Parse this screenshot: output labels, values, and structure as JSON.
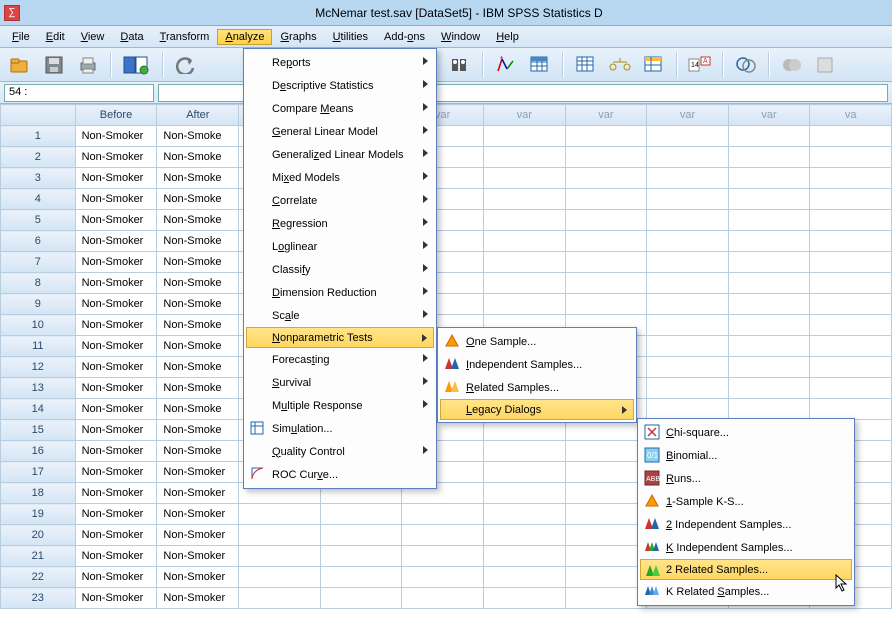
{
  "window": {
    "title": "McNemar test.sav [DataSet5] - IBM SPSS Statistics D"
  },
  "menubar": {
    "file": "File",
    "edit": "Edit",
    "view": "View",
    "data": "Data",
    "transform": "Transform",
    "analyze": "Analyze",
    "graphs": "Graphs",
    "utilities": "Utilities",
    "addons": "Add-ons",
    "window": "Window",
    "help": "Help"
  },
  "ref": {
    "cell": "54 :"
  },
  "columns": {
    "c1": "Before",
    "c2": "After",
    "var": "var"
  },
  "rows": [
    {
      "n": "1",
      "b": "Non-Smoker",
      "a": "Non-Smoke"
    },
    {
      "n": "2",
      "b": "Non-Smoker",
      "a": "Non-Smoke"
    },
    {
      "n": "3",
      "b": "Non-Smoker",
      "a": "Non-Smoke"
    },
    {
      "n": "4",
      "b": "Non-Smoker",
      "a": "Non-Smoke"
    },
    {
      "n": "5",
      "b": "Non-Smoker",
      "a": "Non-Smoke"
    },
    {
      "n": "6",
      "b": "Non-Smoker",
      "a": "Non-Smoke"
    },
    {
      "n": "7",
      "b": "Non-Smoker",
      "a": "Non-Smoke"
    },
    {
      "n": "8",
      "b": "Non-Smoker",
      "a": "Non-Smoke"
    },
    {
      "n": "9",
      "b": "Non-Smoker",
      "a": "Non-Smoke"
    },
    {
      "n": "10",
      "b": "Non-Smoker",
      "a": "Non-Smoke"
    },
    {
      "n": "11",
      "b": "Non-Smoker",
      "a": "Non-Smoke"
    },
    {
      "n": "12",
      "b": "Non-Smoker",
      "a": "Non-Smoke"
    },
    {
      "n": "13",
      "b": "Non-Smoker",
      "a": "Non-Smoke"
    },
    {
      "n": "14",
      "b": "Non-Smoker",
      "a": "Non-Smoke"
    },
    {
      "n": "15",
      "b": "Non-Smoker",
      "a": "Non-Smoke"
    },
    {
      "n": "16",
      "b": "Non-Smoker",
      "a": "Non-Smoke"
    },
    {
      "n": "17",
      "b": "Non-Smoker",
      "a": "Non-Smoker"
    },
    {
      "n": "18",
      "b": "Non-Smoker",
      "a": "Non-Smoker"
    },
    {
      "n": "19",
      "b": "Non-Smoker",
      "a": "Non-Smoker"
    },
    {
      "n": "20",
      "b": "Non-Smoker",
      "a": "Non-Smoker"
    },
    {
      "n": "21",
      "b": "Non-Smoker",
      "a": "Non-Smoker"
    },
    {
      "n": "22",
      "b": "Non-Smoker",
      "a": "Non-Smoker"
    },
    {
      "n": "23",
      "b": "Non-Smoker",
      "a": "Non-Smoker"
    }
  ],
  "analyze_menu": {
    "reports": "Reports",
    "descriptive": "Descriptive Statistics",
    "compare": "Compare Means",
    "glm": "General Linear Model",
    "genlin": "Generalized Linear Models",
    "mixed": "Mixed Models",
    "correlate": "Correlate",
    "regression": "Regression",
    "loglinear": "Loglinear",
    "classify": "Classify",
    "dimred": "Dimension Reduction",
    "scale": "Scale",
    "nonpar": "Nonparametric Tests",
    "forecast": "Forecasting",
    "survival": "Survival",
    "multresp": "Multiple Response",
    "simulation": "Simulation...",
    "qc": "Quality Control",
    "roc": "ROC Curve..."
  },
  "nonpar_menu": {
    "one": "One Sample...",
    "ind": "Independent Samples...",
    "rel": "Related Samples...",
    "legacy": "Legacy Dialogs"
  },
  "legacy_menu": {
    "chi": "Chi-square...",
    "binom": "Binomial...",
    "runs": "Runs...",
    "ks": "1-Sample K-S...",
    "ind2": "2 Independent Samples...",
    "kind": "K Independent Samples...",
    "rel2": "2 Related Samples...",
    "krel": "K Related Samples..."
  }
}
